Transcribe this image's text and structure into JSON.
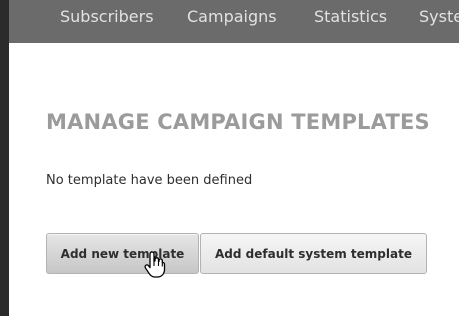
{
  "nav": {
    "items": [
      {
        "label": "Subscribers"
      },
      {
        "label": "Campaigns"
      },
      {
        "label": "Statistics"
      },
      {
        "label": "Syste"
      }
    ]
  },
  "main": {
    "title": "MANAGE CAMPAIGN TEMPLATES",
    "empty_message": "No template have been defined",
    "buttons": {
      "add_new": "Add new template",
      "add_default": "Add default system template"
    }
  },
  "colors": {
    "nav_background": "#6b6b6b",
    "nav_text": "#e2e2e2",
    "title_text": "#9b9b9b",
    "body_text": "#2e2e2e"
  },
  "icons": {
    "cursor": "hand-pointer-icon"
  }
}
